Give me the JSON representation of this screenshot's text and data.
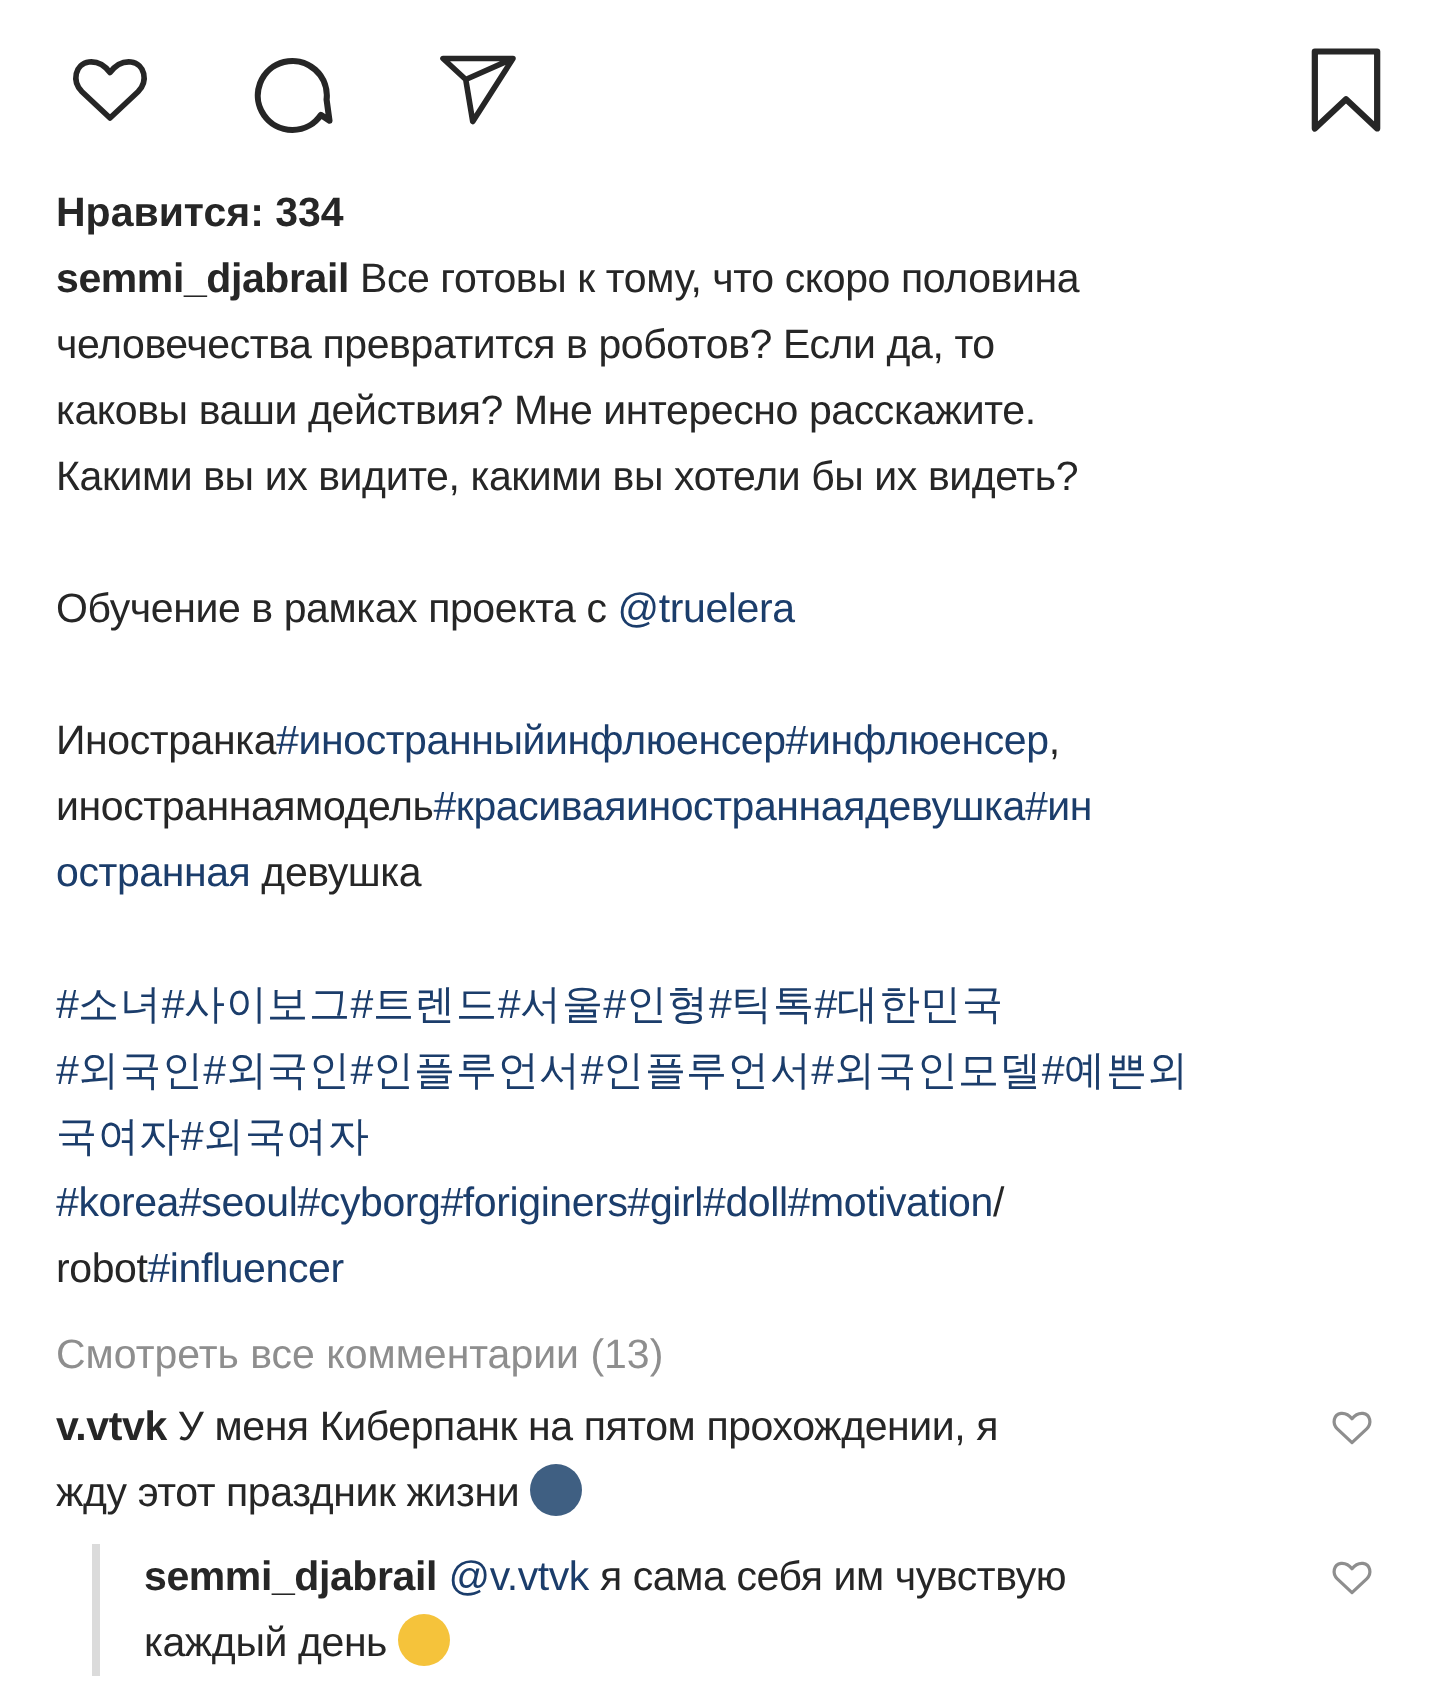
{
  "likes": "Нравится: 334",
  "caption": [
    {
      "lines": [
        [
          {
            "kind": "user",
            "text": "semmi_djabrail"
          },
          {
            "kind": "text",
            "text": " Все готовы к тому, что скоро половина"
          }
        ],
        [
          {
            "kind": "text",
            "text": "человечества превратится в роботов? Если да, то"
          }
        ],
        [
          {
            "kind": "text",
            "text": "каковы ваши действия? Мне интересно расскажите."
          }
        ],
        [
          {
            "kind": "text",
            "text": "Какими вы их видите, какими вы хотели бы их видеть?"
          }
        ]
      ]
    },
    {
      "lines": [
        [
          {
            "kind": "text",
            "text": "Обучение в рамках проекта с  "
          },
          {
            "kind": "mention",
            "text": "@truelera"
          }
        ]
      ]
    },
    {
      "lines": [
        [
          {
            "kind": "text",
            "text": "Иностранка"
          },
          {
            "kind": "tag",
            "text": "#иностранныйинфлюенсер"
          },
          {
            "kind": "tag",
            "text": "#инфлюенсер"
          },
          {
            "kind": "text",
            "text": ","
          }
        ],
        [
          {
            "kind": "text",
            "text": "иностраннаямодель"
          },
          {
            "kind": "tag",
            "text": "#красиваяиностраннаядевушка"
          },
          {
            "kind": "tag",
            "text": "#ин"
          }
        ],
        [
          {
            "kind": "tag",
            "text": "остранная"
          },
          {
            "kind": "text",
            "text": " девушка"
          }
        ]
      ]
    },
    {
      "lines": [
        [
          {
            "kind": "tag",
            "text": "#소녀"
          },
          {
            "kind": "tag",
            "text": "#사이보그"
          },
          {
            "kind": "tag",
            "text": "#트렌드"
          },
          {
            "kind": "tag",
            "text": "#서울"
          },
          {
            "kind": "tag",
            "text": "#인형"
          },
          {
            "kind": "tag",
            "text": "#틱톡"
          },
          {
            "kind": "tag",
            "text": "#대한민국"
          }
        ],
        [
          {
            "kind": "tag",
            "text": "#외국인"
          },
          {
            "kind": "tag",
            "text": "#외국인"
          },
          {
            "kind": "tag",
            "text": "#인플루언서"
          },
          {
            "kind": "tag",
            "text": "#인플루언서"
          },
          {
            "kind": "tag",
            "text": "#외국인모델"
          },
          {
            "kind": "tag",
            "text": "#예쁜외"
          }
        ],
        [
          {
            "kind": "tag",
            "text": "국여자"
          },
          {
            "kind": "tag",
            "text": "#외국여자"
          }
        ],
        [
          {
            "kind": "tag",
            "text": "#korea"
          },
          {
            "kind": "tag",
            "text": "#seoul"
          },
          {
            "kind": "tag",
            "text": "#cyborg"
          },
          {
            "kind": "tag",
            "text": "#foriginers"
          },
          {
            "kind": "tag",
            "text": "#girl"
          },
          {
            "kind": "tag",
            "text": "#doll"
          },
          {
            "kind": "tag",
            "text": "#motivation"
          },
          {
            "kind": "text",
            "text": "/"
          }
        ],
        [
          {
            "kind": "text",
            "text": "robot"
          },
          {
            "kind": "tag",
            "text": "#influencer"
          }
        ]
      ]
    }
  ],
  "view_all": "Смотреть все комментарии (13)",
  "comments": [
    {
      "kind": "comment",
      "lines": [
        [
          {
            "kind": "user",
            "text": "v.vtvk"
          },
          {
            "kind": "text",
            "text": " У меня Киберпанк на пятом прохождении, я"
          }
        ],
        [
          {
            "kind": "text",
            "text": "жду этот праздник жизни "
          },
          {
            "kind": "emoji",
            "color": "#3f5f82"
          }
        ]
      ]
    },
    {
      "kind": "reply",
      "lines": [
        [
          {
            "kind": "user",
            "text": "semmi_djabrail"
          },
          {
            "kind": "mention",
            "text": "@v.vtvk"
          },
          {
            "kind": "text",
            "text": " я сама себя им чувствую"
          }
        ],
        [
          {
            "kind": "text",
            "text": "каждый день "
          },
          {
            "kind": "emoji",
            "color": "#f5c33b"
          }
        ]
      ]
    }
  ]
}
